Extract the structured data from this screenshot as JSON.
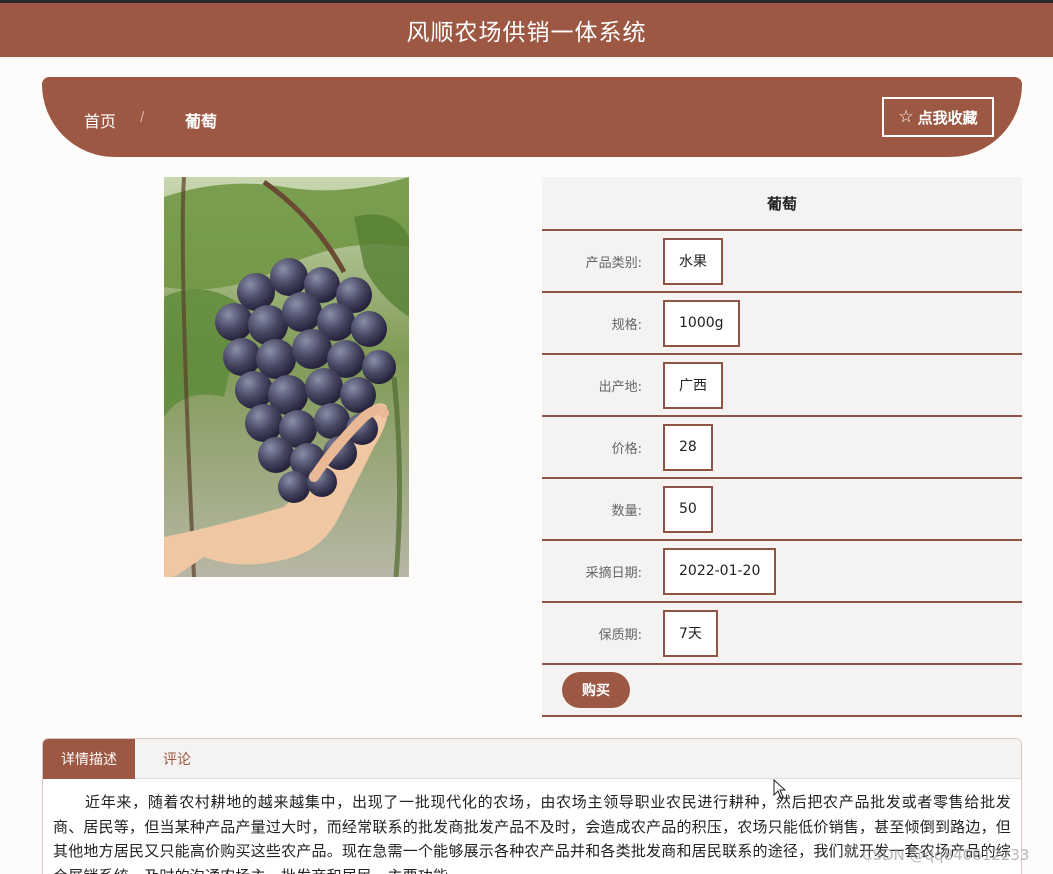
{
  "header": {
    "title": "风顺农场供销一体系统"
  },
  "breadcrumb": {
    "home": "首页",
    "separator": "/",
    "current": "葡萄"
  },
  "favorite": {
    "icon": "star-outline-icon",
    "label": "点我收藏"
  },
  "product": {
    "name": "葡萄",
    "fields": [
      {
        "label": "产品类别:",
        "value": "水果"
      },
      {
        "label": "规格:",
        "value": "1000g"
      },
      {
        "label": "出产地:",
        "value": "广西"
      },
      {
        "label": "价格:",
        "value": "28"
      },
      {
        "label": "数量:",
        "value": "50"
      },
      {
        "label": "采摘日期:",
        "value": "2022-01-20"
      },
      {
        "label": "保质期:",
        "value": "7天"
      }
    ],
    "buy_label": "购买"
  },
  "tabs": [
    {
      "label": "详情描述",
      "active": true
    },
    {
      "label": "评论",
      "active": false
    }
  ],
  "description": "近年来，随着农村耕地的越来越集中，出现了一批现代化的农场，由农场主领导职业农民进行耕种，然后把农产品批发或者零售给批发商、居民等，但当某种产品产量过大时，而经常联系的批发商批发产品不及时，会造成农产品的积压，农场只能低价销售，甚至倾倒到路边，但其他地方居民又只能高价购买这些农产品。现在急需一个能够展示各种农产品并和各类批发商和居民联系的途径，我们就开发一套农场产品的综合展销系统，及时的沟通农场主、批发商和居民，主要功能",
  "watermark": "CSDN @qq840612233",
  "colors": {
    "brand": "#9d5843",
    "border": "#8f5444",
    "panel": "#f4f3f1"
  }
}
